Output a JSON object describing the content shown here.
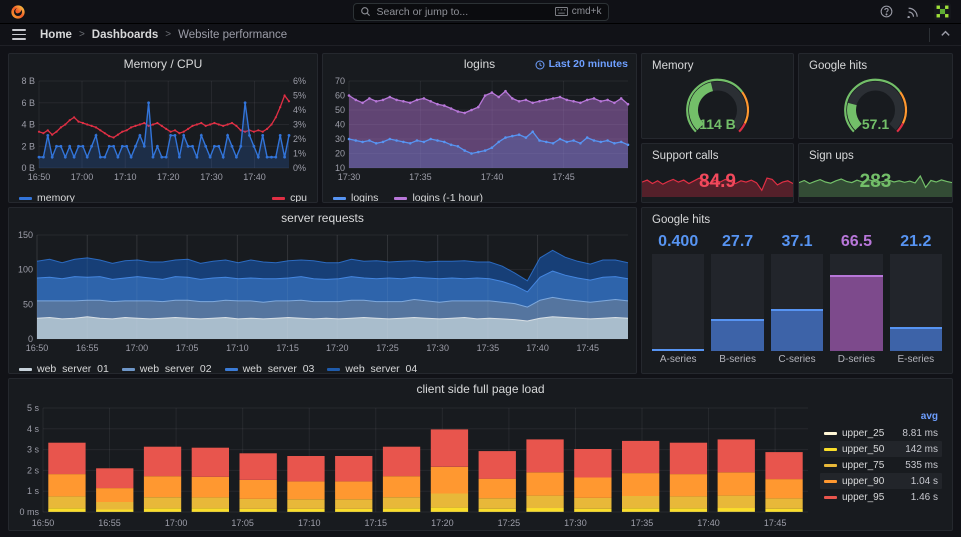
{
  "topbar": {
    "search_placeholder": "Search or jump to...",
    "shortcut": "cmd+k"
  },
  "breadcrumb": {
    "items": [
      "Home",
      "Dashboards",
      "Website performance"
    ],
    "separator": ">"
  },
  "colors": {
    "background": "#111217",
    "panel": "#181b1f",
    "blue": "#3274d9",
    "light_blue": "#5794f2",
    "red": "#e02f44",
    "stat_red": "#f2495c",
    "purple": "#b877d9",
    "green": "#73bf69",
    "link_blue": "#6e9fff",
    "yellow": "#fade2a",
    "gold": "#e8b839",
    "orange": "#ff9830"
  },
  "panels": {
    "memcpu": {
      "title": "Memory / CPU",
      "legend": [
        "memory",
        "cpu"
      ]
    },
    "logins": {
      "title": "logins",
      "time_range": "Last 20 minutes",
      "legend": [
        "logins",
        "logins (-1 hour)"
      ]
    },
    "memory_gauge": {
      "title": "Memory",
      "value": "114 B"
    },
    "google_gauge": {
      "title": "Google hits",
      "value": "57.1"
    },
    "support": {
      "title": "Support calls",
      "value": "84.9"
    },
    "signups": {
      "title": "Sign ups",
      "value": "283"
    },
    "serverreq": {
      "title": "server requests",
      "legend": [
        "web_server_01",
        "web_server_02",
        "web_server_03",
        "web_server_04"
      ]
    },
    "ghits_bar": {
      "title": "Google hits"
    },
    "pageload": {
      "title": "client side full page load",
      "legend_header": "avg"
    }
  },
  "chart_data": {
    "memcpu": {
      "type": "line",
      "title": "Memory / CPU",
      "x_ticks": [
        {
          "p": 0,
          "l": "16:50"
        },
        {
          "p": 0.172,
          "l": "17:00"
        },
        {
          "p": 0.345,
          "l": "17:10"
        },
        {
          "p": 0.517,
          "l": "17:20"
        },
        {
          "p": 0.69,
          "l": "17:30"
        },
        {
          "p": 0.862,
          "l": "17:40"
        }
      ],
      "left_axis": {
        "min": 0,
        "max": 8,
        "labels": [
          "0 B",
          "2 B",
          "4 B",
          "6 B",
          "8 B"
        ]
      },
      "right_axis": {
        "min": 0,
        "max": 6,
        "labels": [
          "0%",
          "1%",
          "2%",
          "3%",
          "4%",
          "5%",
          "6%"
        ]
      },
      "series": [
        {
          "name": "memory",
          "axis": "left",
          "color": "#3274d9",
          "fill": 0.22,
          "dots": 1.4,
          "width": 1.4,
          "values": [
            1,
            1,
            3,
            1,
            2,
            2,
            1,
            2,
            1,
            2,
            2,
            1,
            2,
            3,
            1,
            1,
            2,
            2,
            1,
            2,
            2,
            1,
            2,
            3,
            2,
            6,
            1,
            2,
            1,
            1,
            3,
            3,
            1,
            3,
            2,
            2,
            1,
            3,
            2,
            1,
            2,
            2,
            1,
            3,
            2,
            1,
            2,
            6,
            3,
            2,
            1,
            3,
            1,
            1,
            1,
            3,
            1,
            3
          ]
        },
        {
          "name": "cpu",
          "axis": "right",
          "color": "#e02f44",
          "dots": 1.1,
          "width": 1.3,
          "values": [
            2.5,
            2.4,
            2.6,
            2.3,
            2.5,
            2.8,
            3.0,
            3.3,
            3.5,
            3.2,
            3.1,
            3.0,
            2.9,
            2.8,
            2.6,
            2.4,
            2.2,
            2.1,
            2.3,
            2.5,
            2.6,
            2.8,
            2.9,
            3.0,
            3.1,
            2.9,
            3.0,
            3.1,
            2.9,
            2.7,
            2.5,
            2.6,
            2.4,
            2.5,
            2.7,
            2.9,
            3.0,
            3.1,
            2.9,
            3.0,
            3.1,
            3.0,
            2.9,
            3.0,
            3.1,
            2.9,
            2.6,
            2.5,
            2.6,
            2.5,
            2.6,
            2.5,
            2.7,
            3.0,
            3.5,
            4.2,
            5.0,
            4.6
          ]
        }
      ]
    },
    "logins": {
      "type": "line",
      "title": "logins",
      "x_ticks": [
        {
          "p": 0,
          "l": "17:30"
        },
        {
          "p": 0.256,
          "l": "17:35"
        },
        {
          "p": 0.513,
          "l": "17:40"
        },
        {
          "p": 0.769,
          "l": "17:45"
        }
      ],
      "left_axis": {
        "min": 10,
        "max": 70,
        "labels": [
          "10",
          "20",
          "30",
          "40",
          "50",
          "60",
          "70"
        ]
      },
      "series": [
        {
          "name": "logins",
          "axis": "left",
          "color": "#5794f2",
          "fill": 0.2,
          "dots": 1.3,
          "width": 1.3,
          "values": [
            30,
            29,
            28,
            29,
            27,
            28,
            30,
            29,
            28,
            27,
            29,
            28,
            30,
            29,
            28,
            26,
            25,
            22,
            20,
            21,
            22,
            24,
            28,
            31,
            32,
            33,
            31,
            35,
            29,
            28,
            27,
            30,
            28,
            29,
            27,
            31,
            29,
            28,
            29,
            27,
            28,
            26
          ]
        },
        {
          "name": "logins (-1 hour)",
          "axis": "left",
          "color": "#b877d9",
          "fill": 0.45,
          "dots": 1.3,
          "width": 1.3,
          "values": [
            60,
            57,
            55,
            58,
            56,
            57,
            59,
            57,
            56,
            55,
            57,
            58,
            56,
            54,
            53,
            51,
            49,
            48,
            50,
            52,
            60,
            62,
            59,
            63,
            58,
            56,
            57,
            55,
            56,
            57,
            58,
            59,
            57,
            56,
            55,
            57,
            58,
            56,
            57,
            55,
            58,
            54
          ]
        }
      ]
    },
    "memory_gauge": {
      "type": "gauge",
      "title": "Memory",
      "display": "114 B",
      "value": 114,
      "unit": "B",
      "percent": 0.45,
      "color": "#73bf69"
    },
    "google_gauge": {
      "type": "gauge",
      "title": "Google hits",
      "display": "57.1",
      "value": 57.1,
      "percent": 0.22,
      "color": "#73bf69"
    },
    "support_spark": {
      "type": "sparkline",
      "title": "Support calls",
      "display": "84.9",
      "color": "#e02f44",
      "value_color": "#f2495c",
      "min": 60,
      "max": 100,
      "values": [
        82,
        85,
        80,
        84,
        79,
        83,
        86,
        82,
        85,
        80,
        84,
        88,
        83,
        80,
        85,
        82,
        86,
        83,
        80,
        84,
        82,
        85,
        81,
        70,
        88,
        86,
        78,
        82,
        84,
        80
      ]
    },
    "signups_spark": {
      "type": "sparkline",
      "title": "Sign ups",
      "display": "283",
      "color": "#73bf69",
      "value_color": "#73bf69",
      "min": 230,
      "max": 320,
      "values": [
        278,
        285,
        275,
        282,
        288,
        280,
        276,
        284,
        290,
        282,
        278,
        286,
        280,
        288,
        284,
        278,
        282,
        286,
        280,
        284,
        279,
        283,
        277,
        300,
        262,
        285,
        280,
        287,
        282,
        278
      ]
    },
    "serverreq": {
      "type": "stacked_area",
      "title": "server requests",
      "x_ticks": [
        {
          "p": 0,
          "l": "16:50"
        },
        {
          "p": 0.085,
          "l": "16:55"
        },
        {
          "p": 0.169,
          "l": "17:00"
        },
        {
          "p": 0.254,
          "l": "17:05"
        },
        {
          "p": 0.339,
          "l": "17:10"
        },
        {
          "p": 0.424,
          "l": "17:15"
        },
        {
          "p": 0.508,
          "l": "17:20"
        },
        {
          "p": 0.593,
          "l": "17:25"
        },
        {
          "p": 0.678,
          "l": "17:30"
        },
        {
          "p": 0.763,
          "l": "17:35"
        },
        {
          "p": 0.847,
          "l": "17:40"
        },
        {
          "p": 0.932,
          "l": "17:45"
        }
      ],
      "left_axis": {
        "min": 0,
        "max": 150,
        "labels": [
          "0",
          "50",
          "100",
          "150"
        ]
      },
      "series": [
        {
          "name": "web_server_01",
          "fill": "#a9bdcc",
          "line": "#d8dfe5",
          "values": [
            30,
            31,
            29,
            30,
            32,
            30,
            29,
            31,
            30,
            29,
            30,
            31,
            30,
            29,
            30,
            31,
            29,
            30,
            29,
            30,
            31,
            30,
            29,
            30,
            29,
            30,
            31,
            30,
            29,
            30,
            31,
            30,
            29,
            30,
            31,
            29,
            30,
            29,
            28,
            26,
            30,
            32,
            31,
            30,
            29,
            30,
            31,
            30
          ]
        },
        {
          "name": "web_server_02",
          "fill": "#55759f",
          "line": "#7ea8dc",
          "values": [
            25,
            24,
            26,
            25,
            24,
            26,
            25,
            24,
            25,
            26,
            24,
            25,
            26,
            25,
            24,
            25,
            26,
            25,
            24,
            25,
            24,
            26,
            25,
            24,
            25,
            26,
            25,
            24,
            25,
            24,
            26,
            25,
            24,
            25,
            24,
            26,
            25,
            24,
            23,
            20,
            26,
            28,
            26,
            25,
            24,
            25,
            26,
            25
          ]
        },
        {
          "name": "web_server_03",
          "fill": "#2e64ab",
          "line": "#4486e0",
          "values": [
            33,
            34,
            32,
            35,
            33,
            34,
            32,
            33,
            35,
            33,
            32,
            34,
            33,
            32,
            34,
            33,
            32,
            33,
            34,
            32,
            33,
            34,
            33,
            32,
            33,
            34,
            32,
            33,
            34,
            33,
            32,
            33,
            34,
            33,
            32,
            33,
            32,
            30,
            26,
            22,
            33,
            38,
            35,
            33,
            32,
            34,
            33,
            32
          ]
        },
        {
          "name": "web_server_04",
          "fill": "#173f77",
          "line": "#2b6ac0",
          "values": [
            24,
            26,
            23,
            25,
            28,
            24,
            23,
            25,
            24,
            23,
            25,
            24,
            26,
            23,
            24,
            25,
            23,
            26,
            24,
            23,
            25,
            24,
            26,
            24,
            23,
            25,
            24,
            26,
            23,
            25,
            24,
            23,
            25,
            24,
            26,
            23,
            24,
            22,
            18,
            16,
            28,
            30,
            26,
            24,
            23,
            25,
            24,
            23
          ]
        }
      ]
    },
    "ghits_bar": {
      "type": "bar_gauge",
      "title": "Google hits",
      "max": 85,
      "categories": [
        "A-series",
        "B-series",
        "C-series",
        "D-series",
        "E-series"
      ],
      "values": [
        0.4,
        27.7,
        37.1,
        66.5,
        21.2
      ],
      "display": [
        "0.400",
        "27.7",
        "37.1",
        "66.5",
        "21.2"
      ],
      "value_colors": [
        "#5794f2",
        "#5794f2",
        "#5794f2",
        "#b877d9",
        "#5794f2"
      ],
      "fill_colors": [
        "#3d63a8",
        "#3d63a8",
        "#3d63a8",
        "#7d4a8c",
        "#3d63a8"
      ],
      "edge_colors": [
        "#5794f2",
        "#5794f2",
        "#5794f2",
        "#b877d9",
        "#5794f2"
      ]
    },
    "pageload": {
      "type": "stacked_bar",
      "title": "client side full page load",
      "x_ticks": [
        {
          "p": 0,
          "l": "16:50"
        },
        {
          "p": 0.087,
          "l": "16:55"
        },
        {
          "p": 0.174,
          "l": "17:00"
        },
        {
          "p": 0.261,
          "l": "17:05"
        },
        {
          "p": 0.348,
          "l": "17:10"
        },
        {
          "p": 0.435,
          "l": "17:15"
        },
        {
          "p": 0.522,
          "l": "17:20"
        },
        {
          "p": 0.609,
          "l": "17:25"
        },
        {
          "p": 0.696,
          "l": "17:30"
        },
        {
          "p": 0.783,
          "l": "17:35"
        },
        {
          "p": 0.87,
          "l": "17:40"
        },
        {
          "p": 0.957,
          "l": "17:45"
        }
      ],
      "y_axis": {
        "min": 0,
        "max": 5,
        "labels": [
          "0 ms",
          "1 s",
          "2 s",
          "3 s",
          "4 s",
          "5 s"
        ]
      },
      "legend_header": "avg",
      "series": [
        {
          "name": "upper_25",
          "avg": "8.81 ms",
          "color": "#fff6d5",
          "values": [
            0.01,
            0.01,
            0.01,
            0.01,
            0.01,
            0.01,
            0.01,
            0.01,
            0.01,
            0.01,
            0.01,
            0.01,
            0.01,
            0.01,
            0.01,
            0.01
          ]
        },
        {
          "name": "upper_50",
          "avg": "142 ms",
          "color": "#fade2a",
          "values": [
            0.17,
            0.11,
            0.16,
            0.16,
            0.14,
            0.14,
            0.14,
            0.16,
            0.2,
            0.15,
            0.18,
            0.15,
            0.17,
            0.17,
            0.18,
            0.15
          ]
        },
        {
          "name": "upper_75",
          "avg": "535 ms",
          "color": "#e8b839",
          "values": [
            0.57,
            0.36,
            0.54,
            0.53,
            0.48,
            0.46,
            0.46,
            0.54,
            0.68,
            0.5,
            0.6,
            0.52,
            0.59,
            0.57,
            0.6,
            0.49
          ]
        },
        {
          "name": "upper_90",
          "avg": "1.04 s",
          "color": "#ff9830",
          "values": [
            1.07,
            0.67,
            1.01,
            0.99,
            0.91,
            0.86,
            0.86,
            1.01,
            1.28,
            0.94,
            1.12,
            0.98,
            1.1,
            1.07,
            1.12,
            0.93
          ]
        },
        {
          "name": "upper_95",
          "avg": "1.46 s",
          "color": "#e8554d",
          "values": [
            1.51,
            0.95,
            1.42,
            1.4,
            1.28,
            1.22,
            1.22,
            1.42,
            1.8,
            1.33,
            1.58,
            1.37,
            1.55,
            1.51,
            1.58,
            1.3
          ]
        }
      ]
    }
  }
}
